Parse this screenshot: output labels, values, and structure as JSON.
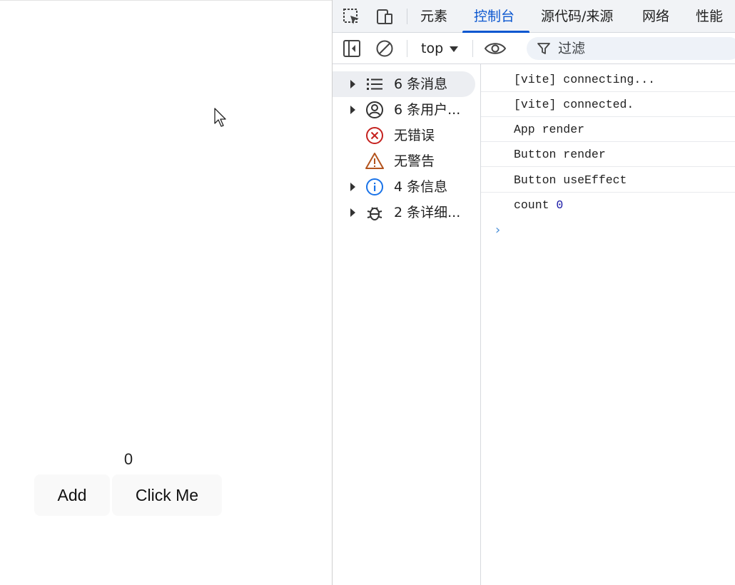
{
  "page": {
    "counter_value": "0",
    "add_label": "Add",
    "click_label": "Click Me"
  },
  "devtools": {
    "tabs": [
      {
        "label": "元素",
        "active": false
      },
      {
        "label": "控制台",
        "active": true
      },
      {
        "label": "源代码/来源",
        "active": false
      },
      {
        "label": "网络",
        "active": false
      },
      {
        "label": "性能",
        "active": false
      }
    ],
    "toolbar": {
      "context": "top",
      "filter_placeholder": "过滤"
    },
    "sidebar": [
      {
        "label": "6 条消息",
        "icon": "list-icon",
        "expandable": true,
        "selected": true
      },
      {
        "label": "6 条用户...",
        "icon": "user-icon",
        "expandable": true,
        "selected": false
      },
      {
        "label": "无错误",
        "icon": "error-icon",
        "expandable": false,
        "selected": false
      },
      {
        "label": "无警告",
        "icon": "warning-icon",
        "expandable": false,
        "selected": false
      },
      {
        "label": "4 条信息",
        "icon": "info-icon",
        "expandable": true,
        "selected": false
      },
      {
        "label": "2 条详细...",
        "icon": "bug-icon",
        "expandable": true,
        "selected": false
      }
    ],
    "logs": [
      {
        "text": "[vite] connecting..."
      },
      {
        "text": "[vite] connected."
      },
      {
        "text": "App render"
      },
      {
        "text": "Button render"
      },
      {
        "text": "Button useEffect"
      },
      {
        "text": "count ",
        "value": "0"
      }
    ],
    "prompt_symbol": "›"
  },
  "colors": {
    "accent": "#0b57d0",
    "error": "#c5221f",
    "warning": "#b3541e",
    "info": "#1a73e8",
    "number": "#1a1aa6"
  }
}
